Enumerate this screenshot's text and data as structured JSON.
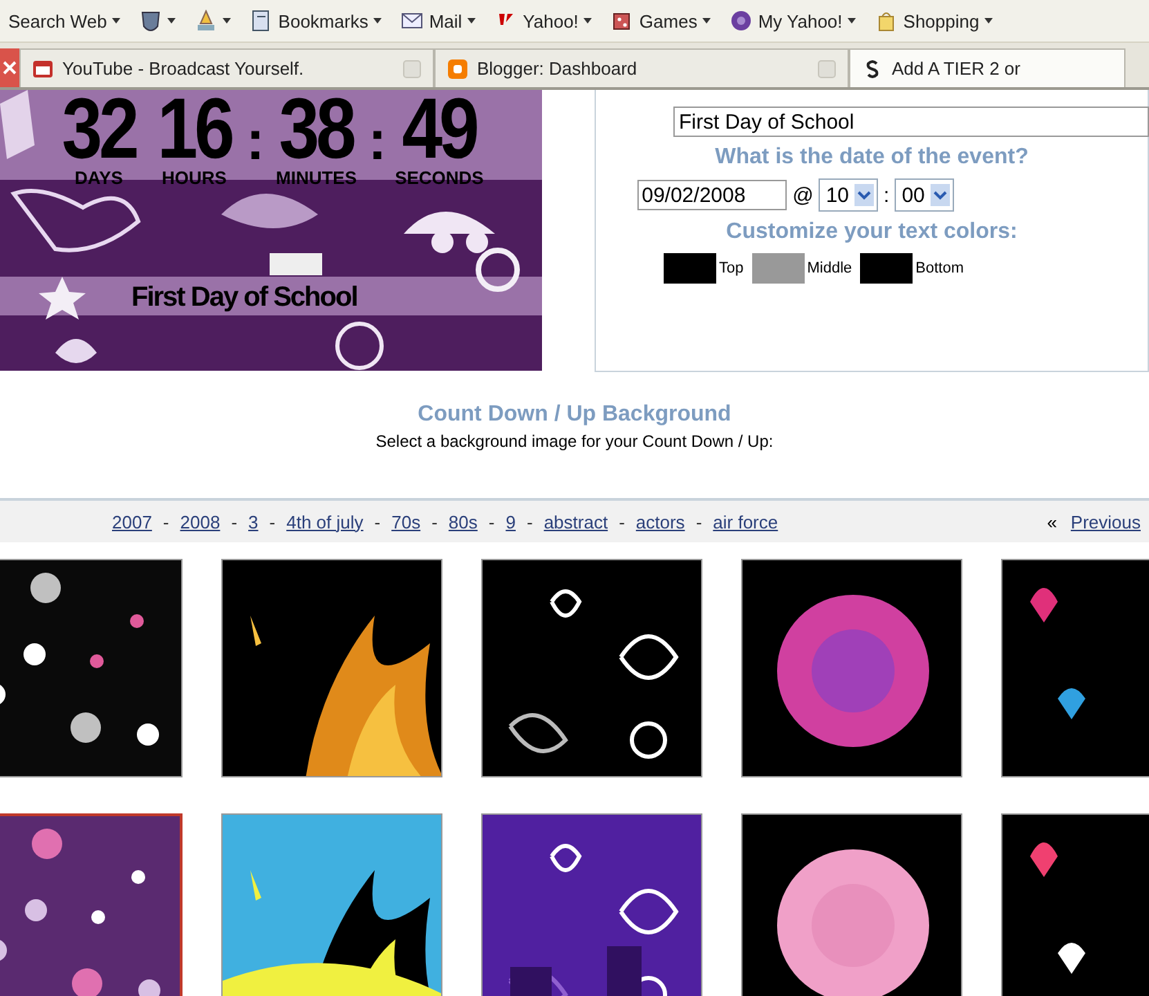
{
  "toolbar": {
    "items": [
      {
        "kind": "search",
        "label": "Search Web"
      },
      {
        "kind": "shield"
      },
      {
        "kind": "pen"
      },
      {
        "kind": "bookmarks",
        "label": "Bookmarks"
      },
      {
        "kind": "mail",
        "label": "Mail"
      },
      {
        "kind": "yahoo",
        "label": "Yahoo!"
      },
      {
        "kind": "games",
        "label": "Games"
      },
      {
        "kind": "myyahoo",
        "label": "My Yahoo!"
      },
      {
        "kind": "shopping",
        "label": "Shopping"
      }
    ]
  },
  "tabs": [
    {
      "kind": "youtube",
      "title": "YouTube - Broadcast Yourself.",
      "selected": false
    },
    {
      "kind": "blogger",
      "title": "Blogger: Dashboard",
      "selected": false
    },
    {
      "kind": "tier",
      "title": "Add A TIER 2 or",
      "selected": true
    }
  ],
  "countdown": {
    "display": [
      {
        "kind": "unit",
        "value": "32",
        "label": "DAYS"
      },
      {
        "kind": "unit",
        "value": "16",
        "label": "HOURS"
      },
      {
        "kind": "separator",
        "text": ":"
      },
      {
        "kind": "unit",
        "value": "38",
        "label": "MINUTES"
      },
      {
        "kind": "separator",
        "text": ":"
      },
      {
        "kind": "unit",
        "value": "49",
        "label": "SECONDS"
      }
    ],
    "event": "First Day of School"
  },
  "form": {
    "event_name": "First Day of School",
    "date_question": "What is the date of the event?",
    "date": "09/02/2008",
    "at": "@",
    "hour": "10",
    "time_separator": ":",
    "minute": "00",
    "colors_question": "Customize your text colors:",
    "colors": [
      {
        "label": "Top",
        "color": "#000000"
      },
      {
        "label": "Middle",
        "color": "#999999"
      },
      {
        "label": "Bottom",
        "color": "#000000"
      }
    ]
  },
  "background": {
    "title": "Count Down / Up Background",
    "subtitle": "Select a background image for your Count Down / Up:",
    "categories": [
      "2007",
      "2008",
      "3",
      "4th of july",
      "70s",
      "80s",
      "9",
      "abstract",
      "actors",
      "air force"
    ],
    "separator": "-",
    "previous_arrow": "«",
    "previous": "Previous",
    "thumbnails": [
      {
        "kind": "picture",
        "selected": false
      },
      {
        "kind": "picture",
        "selected": false
      },
      {
        "kind": "picture",
        "selected": false
      },
      {
        "kind": "picture",
        "selected": false
      },
      {
        "kind": "picture",
        "selected": false
      },
      {
        "kind": "picture",
        "selected": true
      },
      {
        "kind": "picture",
        "selected": false
      },
      {
        "kind": "picture",
        "selected": false
      },
      {
        "kind": "picture",
        "selected": false
      },
      {
        "kind": "picture",
        "selected": false
      }
    ]
  }
}
